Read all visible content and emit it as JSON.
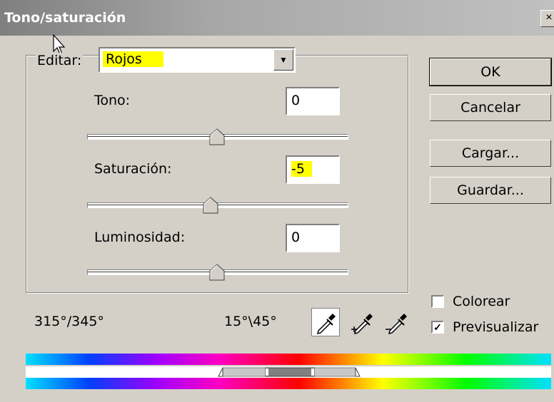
{
  "window": {
    "title": "Tono/saturación",
    "close_label": "×"
  },
  "editar": {
    "label": "Editar:",
    "value": "Rojos",
    "highlight_color": "#ffff00"
  },
  "sliders": [
    {
      "label": "Tono:",
      "value": "0",
      "position": 0.5,
      "highlighted": false
    },
    {
      "label": "Saturación:",
      "value": "-5",
      "position": 0.475,
      "highlighted": true
    },
    {
      "label": "Luminosidad:",
      "value": "0",
      "position": 0.5,
      "highlighted": false
    }
  ],
  "buttons": {
    "ok": "OK",
    "cancel": "Cancelar",
    "load": "Cargar...",
    "save": "Guardar..."
  },
  "checkboxes": {
    "colorize": {
      "label": "Colorear",
      "checked": false
    },
    "preview": {
      "label": "Previsualizar",
      "checked": true
    }
  },
  "ranges": {
    "left": "315°/345°",
    "right": "15°\\45°"
  },
  "eyedroppers": [
    "eyedropper-icon",
    "eyedropper-plus-icon",
    "eyedropper-minus-icon"
  ]
}
